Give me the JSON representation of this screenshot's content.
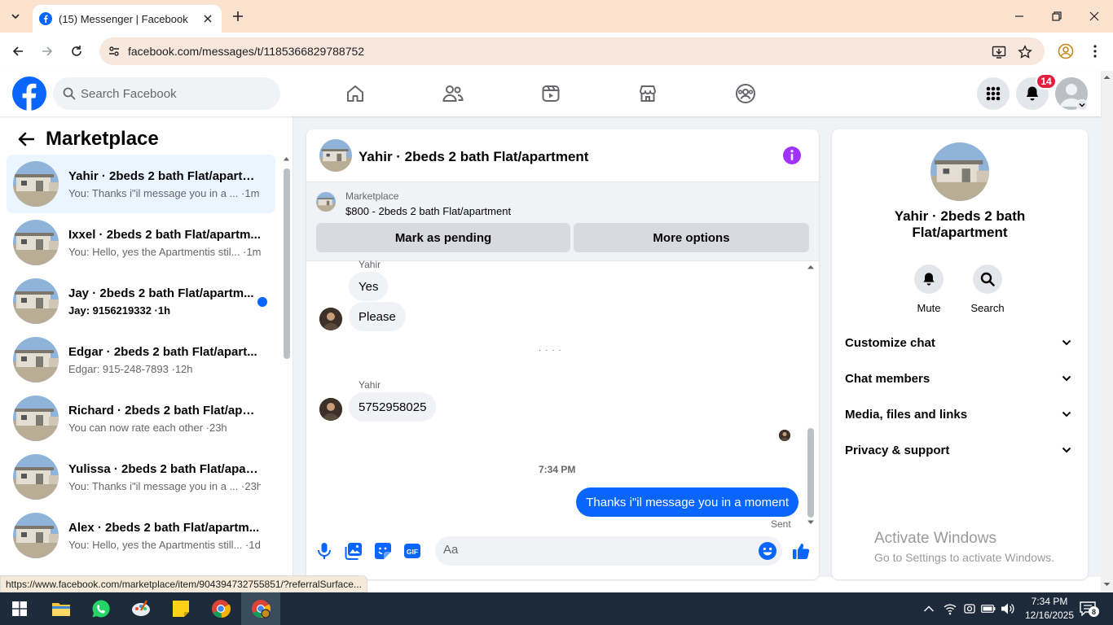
{
  "browser": {
    "tab_title": "(15) Messenger | Facebook",
    "url": "facebook.com/messages/t/1185366829788752",
    "status_url": "https://www.facebook.com/marketplace/item/904394732755851/?referralSurface..."
  },
  "fb": {
    "search_placeholder": "Search Facebook",
    "notification_count": "14",
    "brand_color": "#0866ff"
  },
  "left": {
    "title": "Marketplace",
    "chats": [
      {
        "name": "Yahir · 2beds 2 bath Flat/apartm...",
        "preview": "You: Thanks i\"il message you in a ... ·1m",
        "active": true,
        "unread": false
      },
      {
        "name": "Ixxel · 2beds 2 bath Flat/apartm...",
        "preview": "You: Hello, yes the Apartmentis stil... ·1m",
        "active": false,
        "unread": false
      },
      {
        "name": "Jay · 2beds 2 bath Flat/apartm...",
        "preview": "Jay: 9156219332 ·1h",
        "active": false,
        "unread": true
      },
      {
        "name": "Edgar · 2beds 2 bath Flat/apart...",
        "preview": "Edgar: 915-248-7893 ·12h",
        "active": false,
        "unread": false
      },
      {
        "name": "Richard · 2beds 2 bath Flat/apar...",
        "preview": "You can now rate each other ·23h",
        "active": false,
        "unread": false
      },
      {
        "name": "Yulissa · 2beds 2 bath Flat/apart...",
        "preview": "You: Thanks i\"il message you in a ... ·23h",
        "active": false,
        "unread": false
      },
      {
        "name": "Alex · 2beds 2 bath Flat/apartm...",
        "preview": "You: Hello, yes the Apartmentis still... ·1d",
        "active": false,
        "unread": false
      }
    ]
  },
  "chat": {
    "title": "Yahir · 2beds 2 bath Flat/apartment",
    "marketplace_label": "Marketplace",
    "listing": "$800 - 2beds 2 bath Flat/apartment",
    "mark_pending": "Mark as pending",
    "more_options": "More options",
    "messages": {
      "sender1": "Yahir",
      "m1": "Yes",
      "m2": "Please",
      "typing": "· · · ·",
      "sender2": "Yahir",
      "m3": "5752958025",
      "time": "7:34 PM",
      "m4": "Thanks i\"il message you in a moment",
      "status": "Sent"
    },
    "composer_placeholder": "Aa"
  },
  "right": {
    "name": "Yahir · 2beds 2 bath Flat/apartment",
    "mute": "Mute",
    "search": "Search",
    "sections": [
      "Customize chat",
      "Chat members",
      "Media, files and links",
      "Privacy & support"
    ]
  },
  "watermark": {
    "line1": "Activate Windows",
    "line2": "Go to Settings to activate Windows."
  },
  "taskbar": {
    "time": "7:34 PM",
    "date": "12/16/2025",
    "notif_count": "8"
  }
}
